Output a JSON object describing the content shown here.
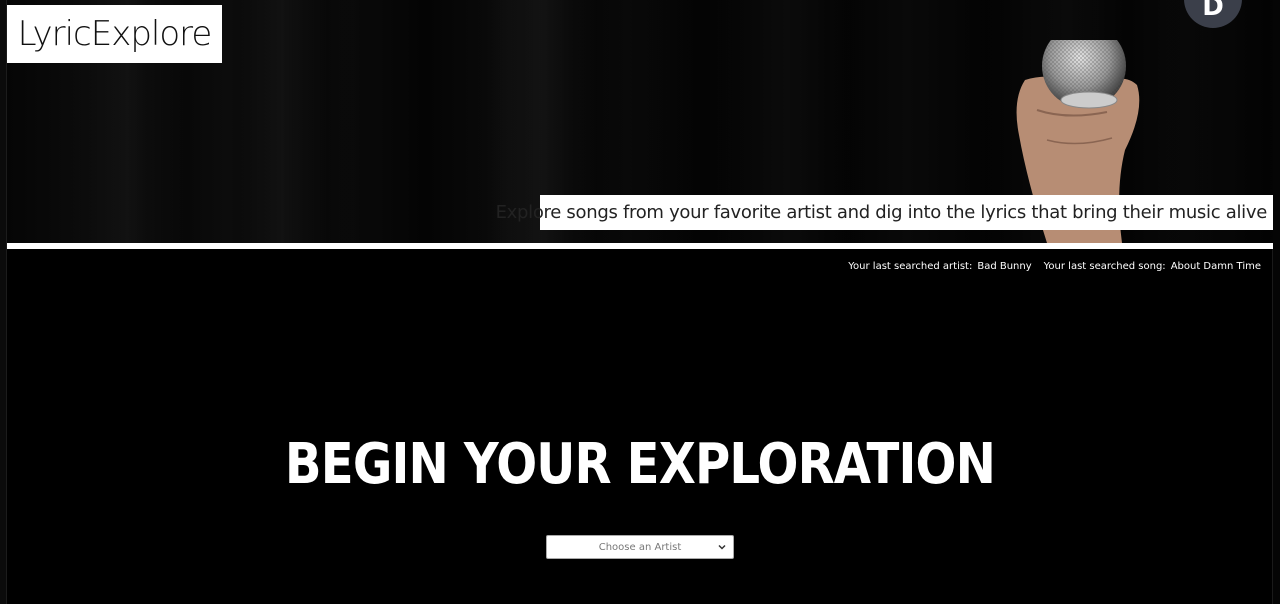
{
  "header": {
    "logo": "LyricExplore",
    "tagline": "Explore songs from your favorite artist and dig into the lyrics that bring their music alive"
  },
  "avatar": {
    "letter": "D"
  },
  "last_searched": {
    "artist_label": "Your last searched artist:",
    "artist_value": "Bad Bunny",
    "song_label": "Your last searched song:",
    "song_value": "About Damn Time"
  },
  "main": {
    "heading": "BEGIN YOUR EXPLORATION",
    "artist_select": {
      "selected": "Choose an Artist"
    }
  },
  "colors": {
    "background": "#000000",
    "text": "#ffffff",
    "avatar_bg": "#3b3f4a"
  }
}
